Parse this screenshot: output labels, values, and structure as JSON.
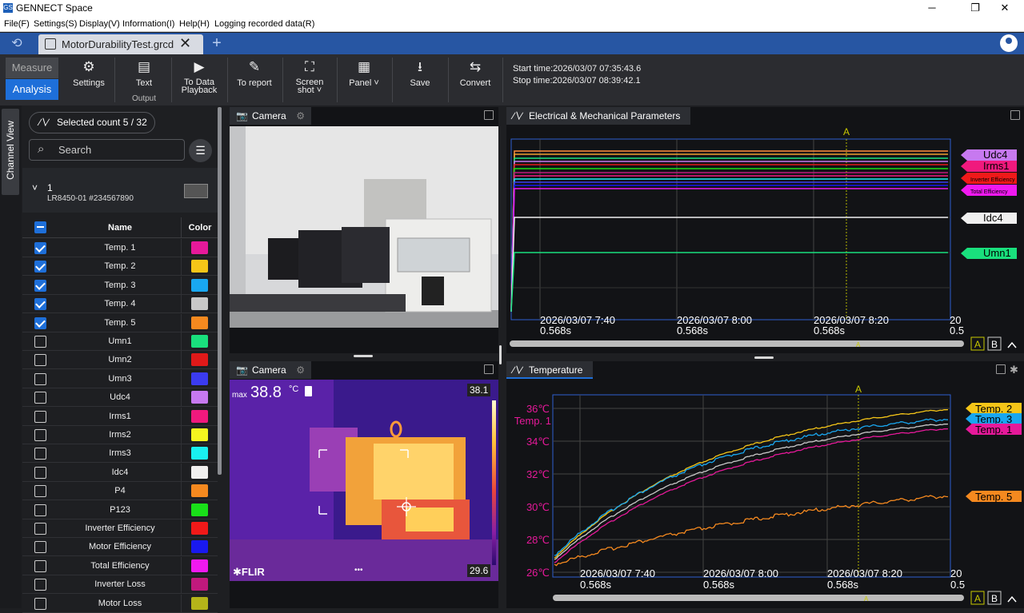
{
  "titlebar": {
    "app_icon": "GS",
    "title": "GENNECT Space",
    "minimize": "─",
    "maximize": "❐",
    "close": "✕"
  },
  "menu": [
    "File(F)",
    "Settings(S)",
    "Display(V)",
    "Information(I)",
    "Help(H)",
    "Logging recorded data(R)"
  ],
  "tabs": {
    "file_tab": "MotorDurabilityTest.grcd",
    "close": "✕",
    "add": "+"
  },
  "toolbar": {
    "mode_measure": "Measure",
    "mode_analysis": "Analysis",
    "settings": "Settings",
    "text": "Text",
    "output": "Output",
    "data_playback_1": "To Data",
    "data_playback_2": "Playback",
    "to_report": "To report",
    "screenshot_1": "Screen",
    "screenshot_2": "shot",
    "panel": "Panel",
    "save": "Save",
    "convert": "Convert",
    "start_time": "Start time:2026/03/07 07:35:43.6",
    "stop_time": "Stop time:2026/03/07 08:39:42.1"
  },
  "side_tab": "Channel View",
  "channel_panel": {
    "selected_count": "Selected count 5 / 32",
    "search_placeholder": "Search",
    "device_number": "1",
    "device_name": "LR8450-01 #234567890",
    "col_name": "Name",
    "col_color": "Color",
    "channels": [
      {
        "name": "Temp. 1",
        "checked": true,
        "color": "#e6199a"
      },
      {
        "name": "Temp. 2",
        "checked": true,
        "color": "#f5c518"
      },
      {
        "name": "Temp. 3",
        "checked": true,
        "color": "#19a7f0"
      },
      {
        "name": "Temp. 4",
        "checked": true,
        "color": "#c8c8c8"
      },
      {
        "name": "Temp. 5",
        "checked": true,
        "color": "#f5891f"
      },
      {
        "name": "Umn1",
        "checked": false,
        "color": "#19e07d"
      },
      {
        "name": "Umn2",
        "checked": false,
        "color": "#e01919"
      },
      {
        "name": "Umn3",
        "checked": false,
        "color": "#3b3bf0"
      },
      {
        "name": "Udc4",
        "checked": false,
        "color": "#c779f0"
      },
      {
        "name": "Irms1",
        "checked": false,
        "color": "#f0197d"
      },
      {
        "name": "Irms2",
        "checked": false,
        "color": "#f5f51f"
      },
      {
        "name": "Irms3",
        "checked": false,
        "color": "#19f0f0"
      },
      {
        "name": "Idc4",
        "checked": false,
        "color": "#f0f0f0"
      },
      {
        "name": "P4",
        "checked": false,
        "color": "#f5891f"
      },
      {
        "name": "P123",
        "checked": false,
        "color": "#19e019"
      },
      {
        "name": "Inverter Efficiency",
        "checked": false,
        "color": "#f01919"
      },
      {
        "name": "Motor Efficiency",
        "checked": false,
        "color": "#1919f0"
      },
      {
        "name": "Total Efficiency",
        "checked": false,
        "color": "#f019f0"
      },
      {
        "name": "Inverter Loss",
        "checked": false,
        "color": "#c0197d"
      },
      {
        "name": "Motor Loss",
        "checked": false,
        "color": "#b4b419"
      }
    ]
  },
  "camera1": {
    "title": "Camera"
  },
  "camera2": {
    "title": "Camera",
    "max_label": "max",
    "max_value": "38.8",
    "unit": "°C",
    "top_value": "38.1",
    "bottom_value": "29.6",
    "brand": "FLIR",
    "dots": "•••"
  },
  "electrical": {
    "title": "Electrical & Mechanical Parameters",
    "cursor_label": "A",
    "x_labels": [
      {
        "date": "2026/03/07 7:40",
        "sub": "0.568s"
      },
      {
        "date": "2026/03/07 8:00",
        "sub": "0.568s"
      },
      {
        "date": "2026/03/07 8:20",
        "sub": "0.568s"
      },
      {
        "date": "20",
        "sub": "0.5"
      }
    ],
    "tags": [
      {
        "text": "Udc4",
        "color": "#c779f0"
      },
      {
        "text": "Irms1",
        "color": "#f0197d"
      },
      {
        "text": "Inverter Efficiency",
        "color": "#f01919"
      },
      {
        "text": "Total Efficiency",
        "color": "#f019f0"
      },
      {
        "text": "Idc4",
        "color": "#f0f0f0"
      },
      {
        "text": "Umn1",
        "color": "#19e07d"
      }
    ],
    "btn_a": "A",
    "btn_b": "B"
  },
  "temperature": {
    "title": "Temperature",
    "cursor_label": "A",
    "axis_name": "Temp. 1",
    "y_ticks": [
      "36℃",
      "34℃",
      "32℃",
      "30℃",
      "28℃",
      "26℃"
    ],
    "x_labels": [
      {
        "date": "2026/03/07 7:40",
        "sub": "0.568s"
      },
      {
        "date": "2026/03/07 8:00",
        "sub": "0.568s"
      },
      {
        "date": "2026/03/07 8:20",
        "sub": "0.568s"
      },
      {
        "date": "20",
        "sub": "0.5"
      }
    ],
    "tags": [
      {
        "text": "Temp. 2",
        "color": "#f5c518"
      },
      {
        "text": "Temp. 3",
        "color": "#19a7f0"
      },
      {
        "text": "Temp. 1",
        "color": "#e6199a"
      },
      {
        "text": "Temp. 5",
        "color": "#f5891f"
      }
    ],
    "btn_a": "A",
    "btn_b": "B"
  }
}
